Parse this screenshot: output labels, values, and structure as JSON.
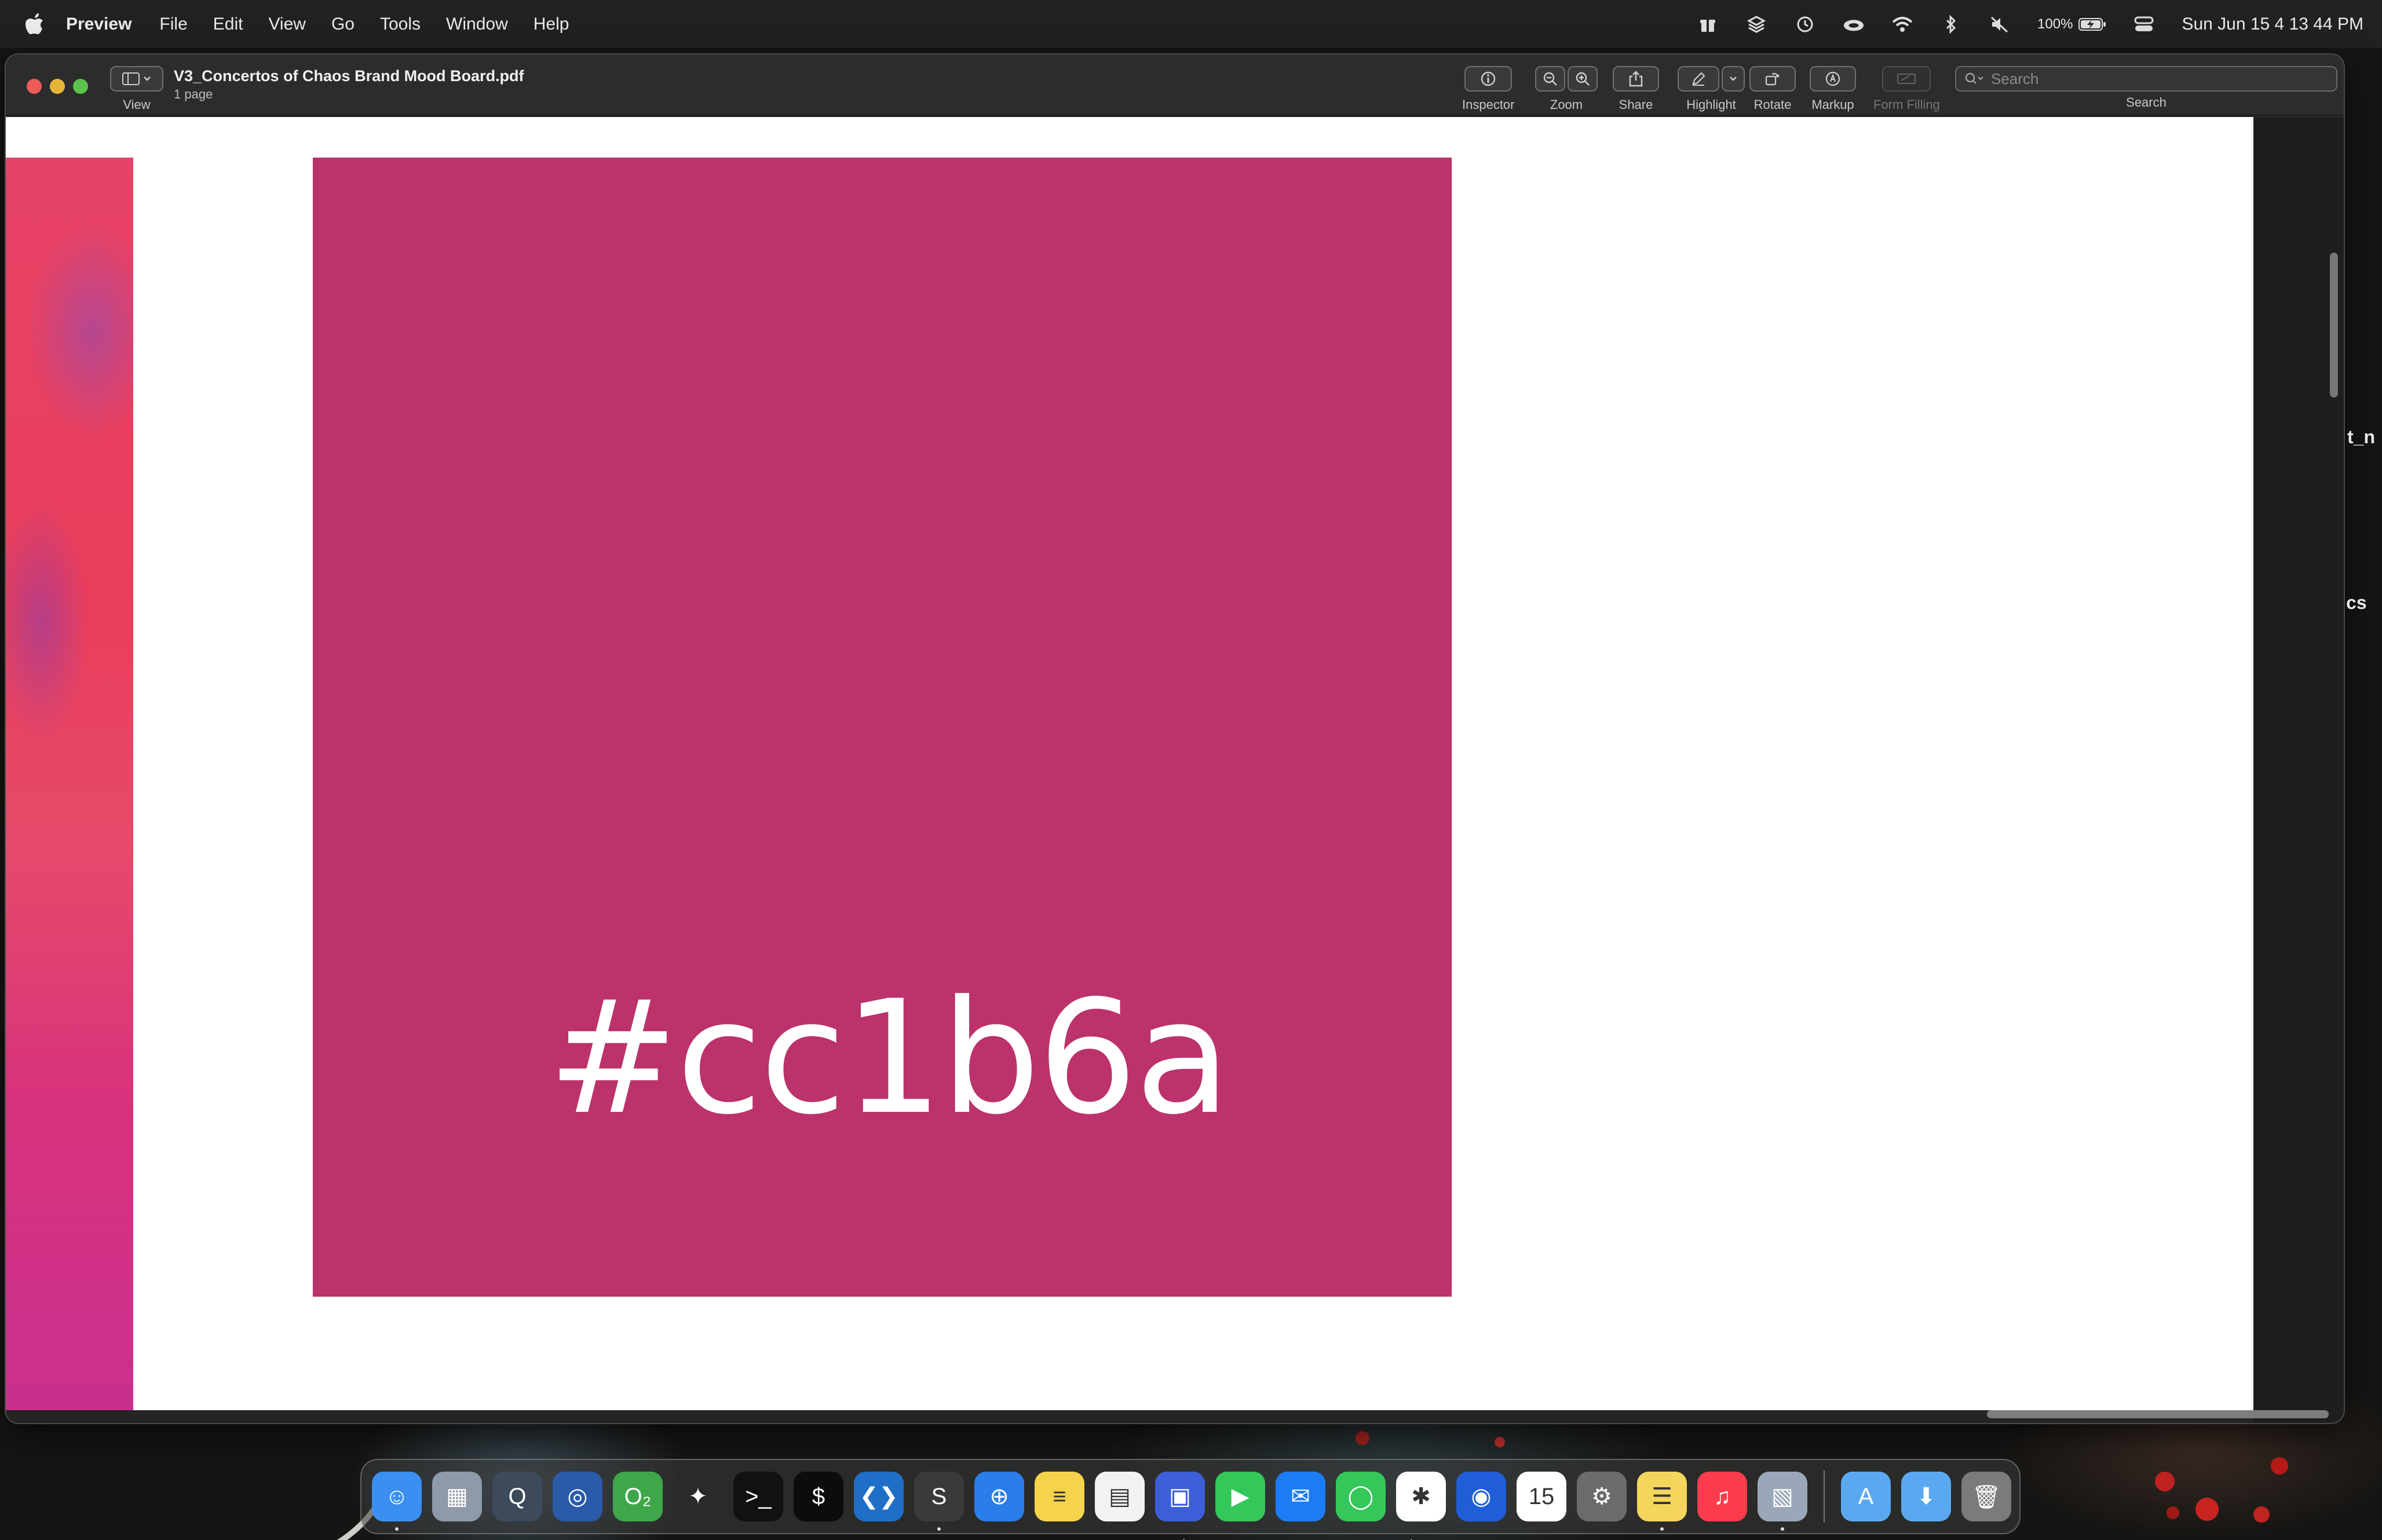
{
  "menubar": {
    "app_name": "Preview",
    "items": [
      "File",
      "Edit",
      "View",
      "Go",
      "Tools",
      "Window",
      "Help"
    ],
    "battery_percent": "100%",
    "clock": "Sun Jun 15  4 13 44 PM",
    "status_icons": [
      "gift-icon",
      "layers-icon",
      "clock-icon",
      "cloud-icon",
      "wifi-icon",
      "bluetooth-icon",
      "mute-icon",
      "battery-icon",
      "control-center-icon"
    ]
  },
  "window": {
    "title": "V3_Concertos of Chaos Brand Mood Board.pdf",
    "subtitle": "1 page",
    "toolbar": {
      "view_label": "View",
      "inspector_label": "Inspector",
      "zoom_label": "Zoom",
      "share_label": "Share",
      "highlight_label": "Highlight",
      "rotate_label": "Rotate",
      "markup_label": "Markup",
      "form_filling_label": "Form Filling",
      "search_label": "Search",
      "search_placeholder": "Search"
    }
  },
  "document": {
    "swatch_hex_text": "#cc1b6a",
    "swatch_color": "#bc326b",
    "prev_page_colors": [
      "#e64368",
      "#d9327c",
      "#c8308e"
    ]
  },
  "edge_text": {
    "line1": "t_n",
    "line2": "cs"
  },
  "dock": {
    "apps": [
      {
        "name": "finder-icon",
        "bg": "#3b8ff0",
        "glyph": "☺",
        "running": true
      },
      {
        "name": "launchpad-icon",
        "bg": "#8e9aa8",
        "glyph": "▦",
        "running": false
      },
      {
        "name": "quicktime-icon",
        "bg": "#3c4a5a",
        "glyph": "Q",
        "running": false
      },
      {
        "name": "oscar-icon",
        "bg": "#2a5aa8",
        "glyph": "◎",
        "running": false
      },
      {
        "name": "o2-icon",
        "bg": "#3fa64a",
        "glyph": "O₂",
        "running": false
      },
      {
        "name": "final-cut-icon",
        "bg": "#2a2a2a",
        "glyph": "✦",
        "running": false
      },
      {
        "name": "terminal-icon",
        "bg": "#111111",
        "glyph": ">_",
        "running": false
      },
      {
        "name": "iterm-icon",
        "bg": "#0c0c0c",
        "glyph": "$",
        "running": false
      },
      {
        "name": "vscode-icon",
        "bg": "#1f6fc8",
        "glyph": "❮❯",
        "running": false
      },
      {
        "name": "sublime-icon",
        "bg": "#3a3a3a",
        "glyph": "S",
        "running": true
      },
      {
        "name": "safari-icon",
        "bg": "#2b7de9",
        "glyph": "⊕",
        "running": false
      },
      {
        "name": "notes-icon",
        "bg": "#f5d34a",
        "glyph": "≡",
        "running": false
      },
      {
        "name": "textedit-icon",
        "bg": "#f2f2f2",
        "glyph": "▤",
        "running": false
      },
      {
        "name": "screen-sharing-icon",
        "bg": "#3c5fd8",
        "glyph": "▣",
        "running": false
      },
      {
        "name": "facetime-icon",
        "bg": "#34c759",
        "glyph": "▶",
        "running": false
      },
      {
        "name": "messenger-icon",
        "bg": "#1c7cf5",
        "glyph": "✉",
        "running": false
      },
      {
        "name": "messages-icon",
        "bg": "#35c75a",
        "glyph": "◯",
        "running": false
      },
      {
        "name": "slack-icon",
        "bg": "#ffffff",
        "glyph": "✱",
        "running": false
      },
      {
        "name": "thunderbird-icon",
        "bg": "#1f5ed8",
        "glyph": "◉",
        "running": false
      },
      {
        "name": "calendar-icon",
        "bg": "#ffffff",
        "glyph": "15",
        "running": false
      },
      {
        "name": "system-settings-icon",
        "bg": "#6b6b6b",
        "glyph": "⚙",
        "running": false
      },
      {
        "name": "stickies-icon",
        "bg": "#f3d65b",
        "glyph": "☰",
        "running": true
      },
      {
        "name": "music-icon",
        "bg": "#fa3c4c",
        "glyph": "♫",
        "running": false
      },
      {
        "name": "preview-icon",
        "bg": "#9aa7b8",
        "glyph": "▧",
        "running": true
      }
    ],
    "folders": [
      {
        "name": "applications-folder-icon",
        "bg": "#5aa9f0",
        "glyph": "A"
      },
      {
        "name": "downloads-folder-icon",
        "bg": "#5aa9f0",
        "glyph": "⬇"
      },
      {
        "name": "trash-icon",
        "bg": "#7b7b7b",
        "glyph": "🗑"
      }
    ]
  }
}
